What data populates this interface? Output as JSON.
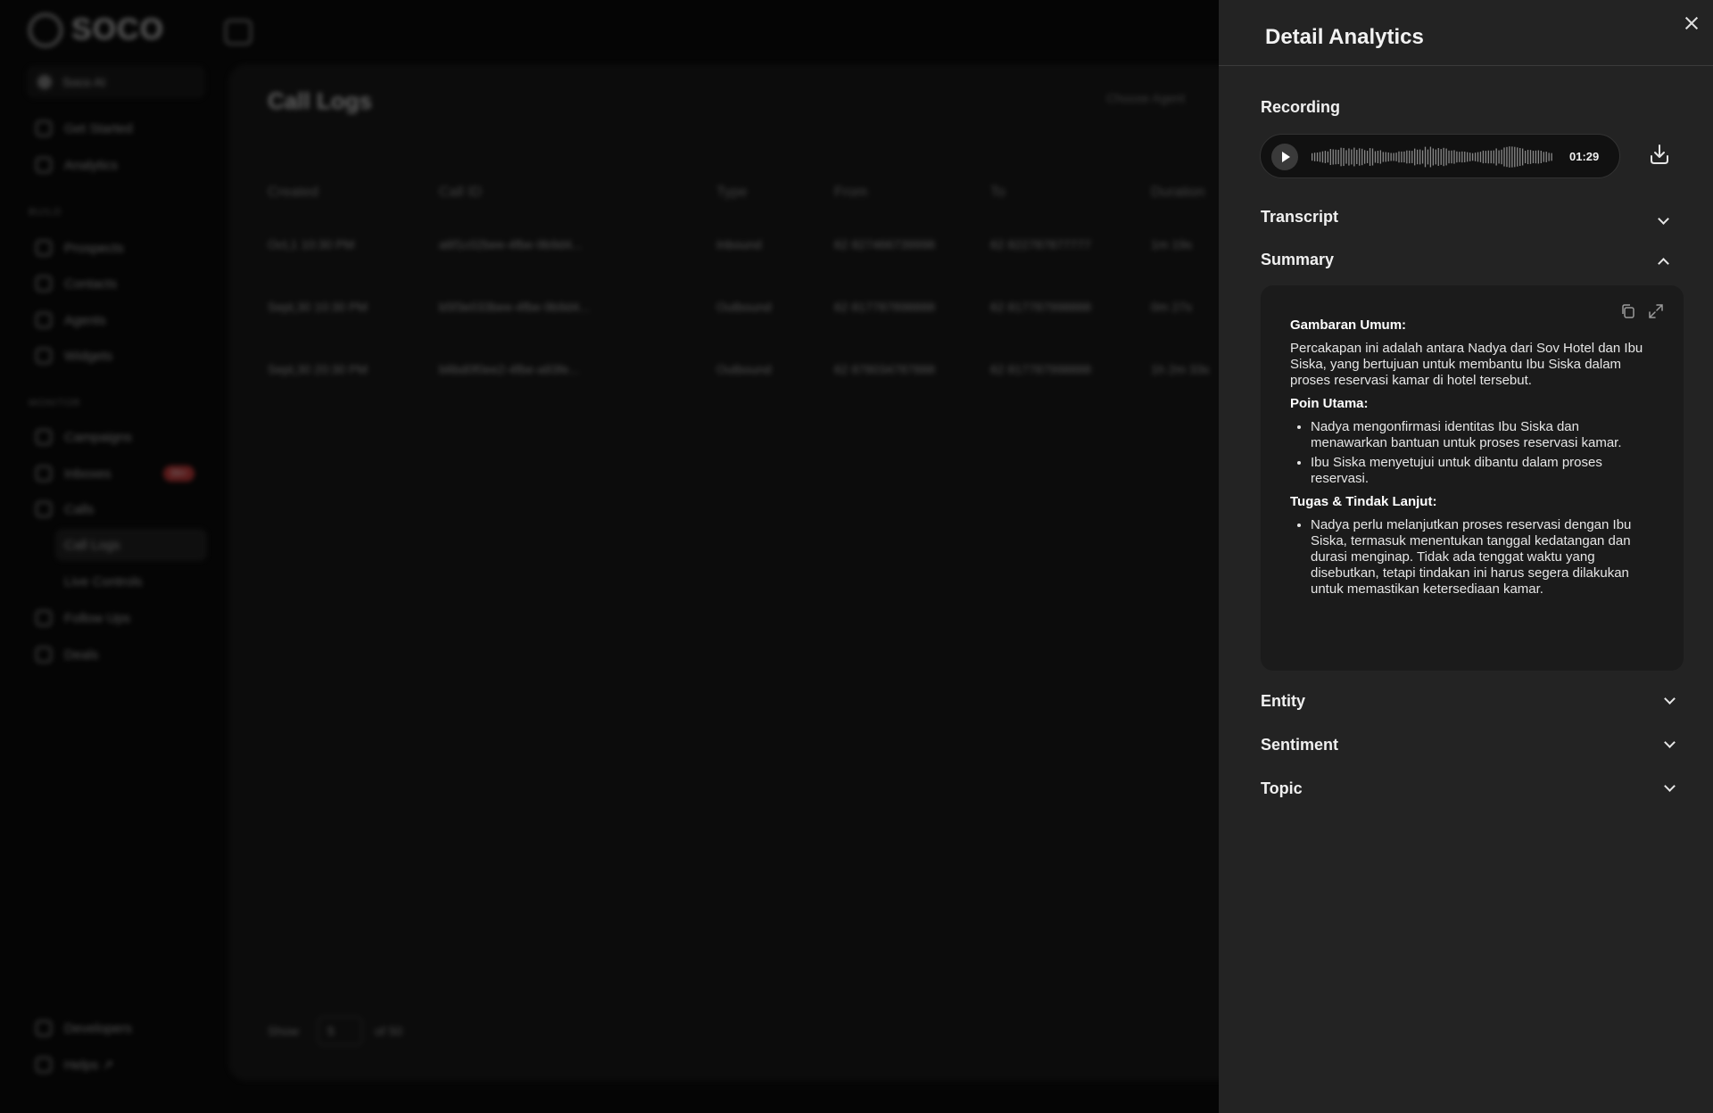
{
  "app": {
    "logo_text": "SOCO"
  },
  "sidebar": {
    "workspace": "Soco AI",
    "section_build": "BUILD",
    "section_monitor": "MONITOR",
    "items": [
      {
        "label": "Get Started"
      },
      {
        "label": "Analytics"
      },
      {
        "label": "Prospects"
      },
      {
        "label": "Contacts"
      },
      {
        "label": "Agents"
      },
      {
        "label": "Widgets"
      },
      {
        "label": "Campaigns"
      },
      {
        "label": "Inboxes",
        "badge": "99+"
      },
      {
        "label": "Calls"
      },
      {
        "label": "Call Logs"
      },
      {
        "label": "Live Controls"
      },
      {
        "label": "Follow Ups"
      },
      {
        "label": "Deals"
      },
      {
        "label": "Developers"
      },
      {
        "label": "Helps ↗"
      }
    ]
  },
  "main": {
    "title": "Call Logs",
    "agent_filter": "Choose Agent",
    "columns": [
      "Created",
      "Call ID",
      "Type",
      "From",
      "To",
      "Duration"
    ],
    "rows": [
      [
        "Oct,1 10:30 PM",
        "a6f1c02bee-4fbe-9b9d4...",
        "Inbound",
        "62 827466739998",
        "62 822787877777",
        "1m 19s"
      ],
      [
        "Sept,30 10:30 PM",
        "b5f3e033bee-4fbe-9b9d4...",
        "Outbound",
        "62 817787898888",
        "62 817787998888",
        "0m 27s"
      ],
      [
        "Sept,30 20:30 PM",
        "b8bd0f0ee2-4fbe-a83fe...",
        "Outbound",
        "62 878034787888",
        "62 817787998888",
        "1h 2m 33s"
      ]
    ],
    "show_label": "Show",
    "page_size": "5",
    "of_label": "of 50"
  },
  "drawer": {
    "title": "Detail Analytics",
    "recording": {
      "label": "Recording",
      "time": "01:29"
    },
    "transcript_label": "Transcript",
    "summary": {
      "label": "Summary",
      "overview_heading": "Gambaran Umum:",
      "overview_text": "Percakapan ini adalah antara Nadya dari Sov Hotel dan Ibu Siska, yang bertujuan untuk membantu Ibu Siska dalam proses reservasi kamar di hotel tersebut.",
      "points_heading": "Poin Utama:",
      "points": [
        "Nadya mengonfirmasi identitas Ibu Siska dan menawarkan bantuan untuk proses reservasi kamar.",
        "Ibu Siska menyetujui untuk dibantu dalam proses reservasi."
      ],
      "tasks_heading": "Tugas & Tindak Lanjut:",
      "tasks": [
        "Nadya perlu melanjutkan proses reservasi dengan Ibu Siska, termasuk menentukan tanggal kedatangan dan durasi menginap. Tidak ada tenggat waktu yang disebutkan, tetapi tindakan ini harus segera dilakukan untuk memastikan ketersediaan kamar."
      ]
    },
    "entity_label": "Entity",
    "sentiment_label": "Sentiment",
    "topic_label": "Topic"
  }
}
